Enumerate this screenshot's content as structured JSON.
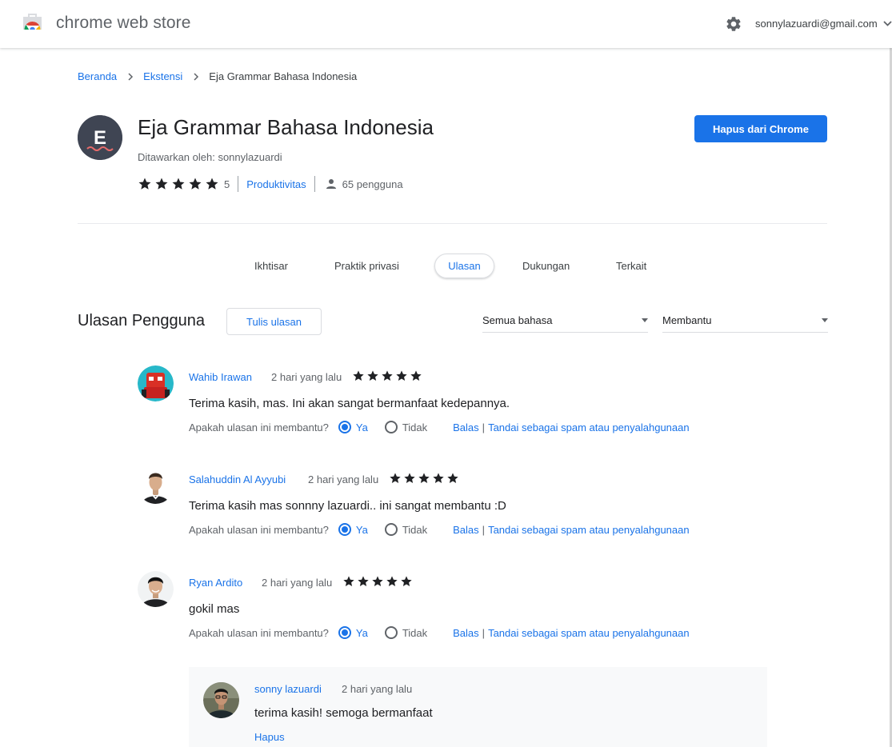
{
  "header": {
    "store_name": "chrome web store",
    "account_email": "sonnylazuardi@gmail.com"
  },
  "breadcrumb": [
    "Beranda",
    "Ekstensi",
    "Eja Grammar Bahasa Indonesia"
  ],
  "item": {
    "icon_letter": "E",
    "title": "Eja Grammar Bahasa Indonesia",
    "offered_by": "Ditawarkan oleh: sonnylazuardi",
    "rating": 5,
    "rating_count": "5",
    "category": "Produktivitas",
    "users": "65 pengguna",
    "remove_button": "Hapus dari Chrome"
  },
  "tabs": [
    {
      "label": "Ikhtisar",
      "active": false
    },
    {
      "label": "Praktik privasi",
      "active": false
    },
    {
      "label": "Ulasan",
      "active": true
    },
    {
      "label": "Dukungan",
      "active": false
    },
    {
      "label": "Terkait",
      "active": false
    }
  ],
  "reviews_section": {
    "title": "Ulasan Pengguna",
    "write_button": "Tulis ulasan",
    "language_select": "Semua bahasa",
    "sort_select": "Membantu"
  },
  "helpful_prompt": "Apakah ulasan ini membantu?",
  "yes_label": "Ya",
  "no_label": "Tidak",
  "reply_label": "Balas",
  "spam_label": "Tandai sebagai spam atau penyalahgunaan",
  "reviews": [
    {
      "name": "Wahib Irawan",
      "date": "2 hari yang lalu",
      "stars": 5,
      "text": "Terima kasih, mas. Ini akan sangat bermanfaat kedepannya.",
      "helpful": "yes"
    },
    {
      "name": "Salahuddin Al Ayyubi",
      "date": "2 hari yang lalu",
      "stars": 5,
      "text": "Terima kasih mas sonnny lazuardi.. ini sangat membantu :D",
      "helpful": "yes"
    },
    {
      "name": "Ryan Ardito",
      "date": "2 hari yang lalu",
      "stars": 5,
      "text": "gokil mas",
      "helpful": "yes"
    }
  ],
  "developer_reply": {
    "name": "sonny lazuardi",
    "date": "2 hari yang lalu",
    "text": "terima kasih! semoga bermanfaat",
    "delete_label": "Hapus"
  },
  "colors": {
    "accent": "#1a73e8",
    "star": "#202124",
    "icon_bg": "#3f4553"
  },
  "icons": [
    "chrome-web-store-logo",
    "gear-icon",
    "chevron-right-icon",
    "star-icon",
    "person-icon",
    "dropdown-caret-icon",
    "chevron-down-icon"
  ]
}
